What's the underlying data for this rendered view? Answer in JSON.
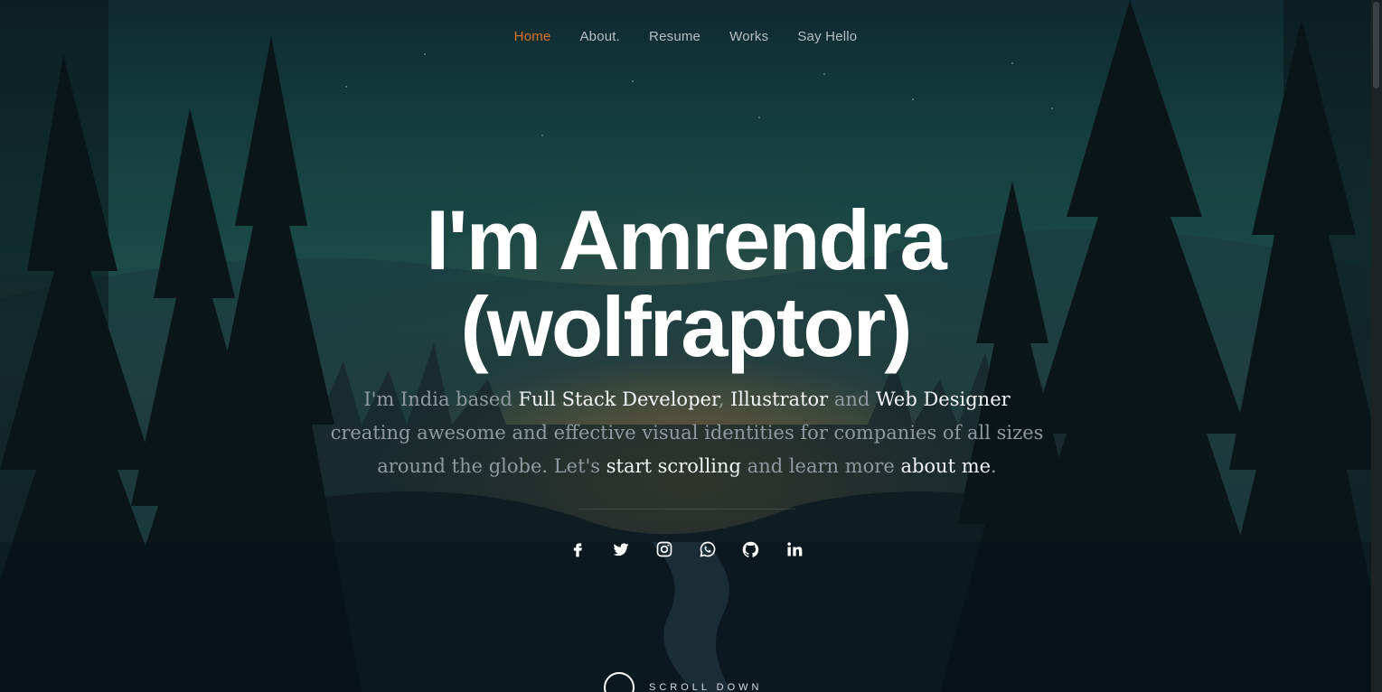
{
  "nav": {
    "items": [
      {
        "label": "Home",
        "active": true
      },
      {
        "label": "About."
      },
      {
        "label": "Resume"
      },
      {
        "label": "Works"
      },
      {
        "label": "Say Hello"
      }
    ]
  },
  "hero": {
    "title_line1": "I'm Amrendra",
    "title_line2": "(wolfraptor)",
    "intro": {
      "p1": "I'm India based ",
      "hl1": "Full Stack Developer",
      "p2": ", ",
      "hl2": "Illustrator",
      "p3": " and ",
      "hl3": "Web Designer",
      "p4": " creating awesome and effective visual identities for companies of all sizes around the globe. Let's ",
      "hl4": "start scrolling",
      "p5": " and learn more ",
      "hl5": "about me",
      "p6": "."
    }
  },
  "social": [
    {
      "icon": "facebook-icon"
    },
    {
      "icon": "twitter-icon"
    },
    {
      "icon": "instagram-icon"
    },
    {
      "icon": "whatsapp-icon"
    },
    {
      "icon": "github-icon"
    },
    {
      "icon": "linkedin-icon"
    }
  ],
  "scroll": {
    "label": "SCROLL DOWN"
  },
  "colors": {
    "accent": "#e0722a",
    "text_muted": "#8f9aa0",
    "text_highlight": "#f2f4f5"
  }
}
